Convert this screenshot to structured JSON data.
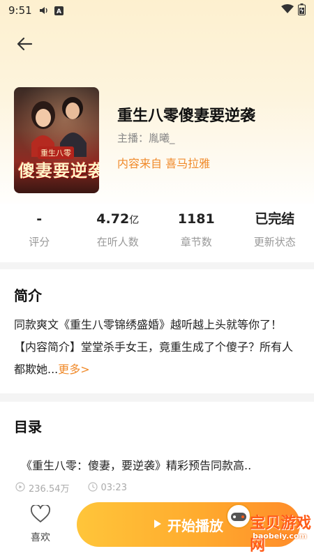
{
  "status_bar": {
    "time": "9:51",
    "icons": [
      "volume-icon",
      "a-badge-icon",
      "wifi-icon",
      "battery-icon"
    ]
  },
  "header": {
    "back_icon": "arrow-left-icon"
  },
  "book": {
    "title": "重生八零傻妻要逆袭",
    "narrator": "主播：胤曦_",
    "source": "内容来自 喜马拉雅",
    "cover": {
      "banner": "重生八零",
      "title": "傻妻要逆袭"
    }
  },
  "stats": [
    {
      "value": "-",
      "unit": "",
      "label": "评分"
    },
    {
      "value": "4.72",
      "unit": "亿",
      "label": "在听人数"
    },
    {
      "value": "1181",
      "unit": "",
      "label": "章节数"
    },
    {
      "value": "已完结",
      "unit": "",
      "label": "更新状态"
    }
  ],
  "intro": {
    "heading": "简介",
    "text": "同款爽文《重生八零锦绣盛婚》越听越上头就等你了！【内容简介】堂堂杀手女王，竟重生成了个傻子？所有人都欺她...",
    "more": "更多>"
  },
  "catalog": {
    "heading": "目录",
    "chapter": {
      "title": "《重生八零：傻妻，要逆袭》精彩预告同款高..",
      "plays": "236.54万",
      "duration": "03:23"
    }
  },
  "bottom_bar": {
    "like_label": "喜欢",
    "play_label": "开始播放"
  },
  "watermark": {
    "text": "宝贝游戏网",
    "url": "baobeiy.com"
  },
  "colors": {
    "accent": "#f08a2a",
    "play_gradient_start": "#ffc53a",
    "play_gradient_end": "#ff8c2a"
  }
}
